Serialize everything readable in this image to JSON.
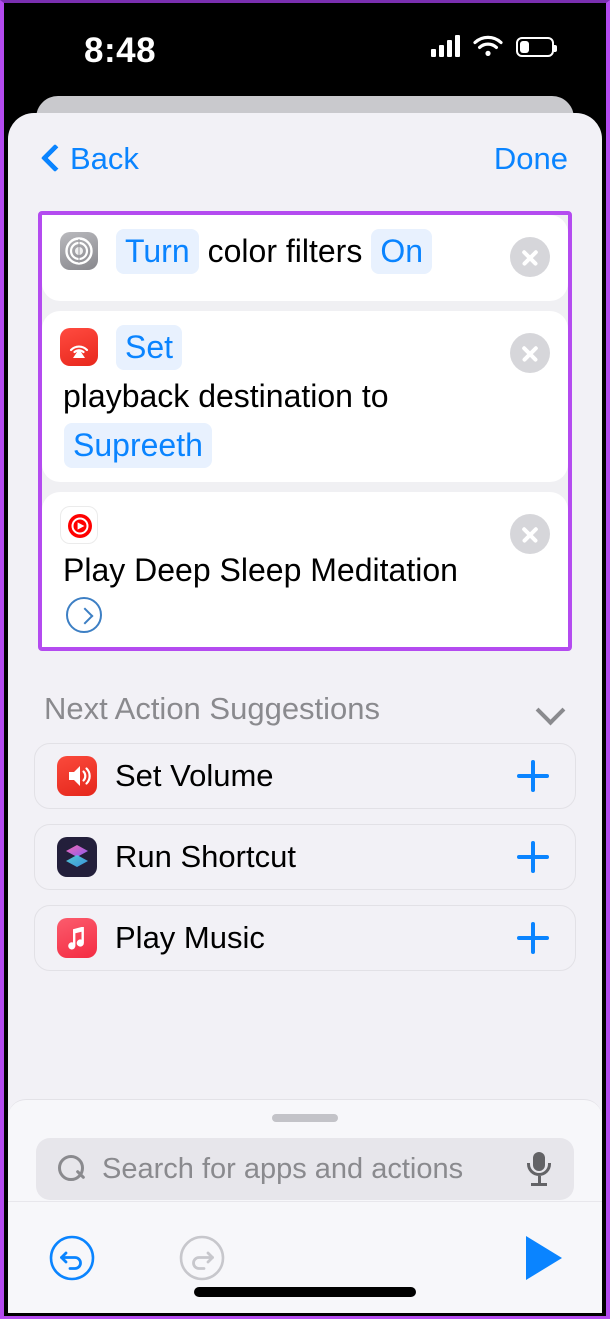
{
  "statusbar": {
    "time": "8:48",
    "signal_icon": "cellular-signal-icon",
    "wifi_icon": "wifi-icon",
    "battery_icon": "battery-icon",
    "battery_level_pct": 30
  },
  "navbar": {
    "back_label": "Back",
    "back_icon": "chevron-left-icon",
    "done_label": "Done"
  },
  "highlight": {
    "color": "#b44bf0"
  },
  "accent": {
    "blue": "#0a84ff",
    "chip_bg": "#e8f1fe",
    "gray_text": "#8a8a8e"
  },
  "actions": [
    {
      "icon": "accessibility-icon",
      "delete_icon": "close-circle-icon",
      "tokens": [
        {
          "text": "Turn",
          "type": "chip"
        },
        {
          "text": "color filters",
          "type": "plain"
        },
        {
          "text": "On",
          "type": "chip"
        }
      ]
    },
    {
      "icon": "airplay-icon",
      "delete_icon": "close-circle-icon",
      "tokens": [
        {
          "text": "Set",
          "type": "chip"
        },
        {
          "text": "playback destination to",
          "type": "plain"
        },
        {
          "text": "Supreeth",
          "type": "chip"
        }
      ]
    },
    {
      "icon": "youtube-music-icon",
      "delete_icon": "close-circle-icon",
      "tokens": [
        {
          "text": "Play Deep Sleep Meditation",
          "type": "plain"
        },
        {
          "text": "",
          "type": "chevron"
        }
      ]
    }
  ],
  "suggestions": {
    "title": "Next Action Suggestions",
    "collapse_icon": "chevron-down-icon",
    "items": [
      {
        "label": "Set Volume",
        "icon": "volume-icon",
        "add_icon": "plus-icon"
      },
      {
        "label": "Run Shortcut",
        "icon": "shortcuts-icon",
        "add_icon": "plus-icon"
      },
      {
        "label": "Play Music",
        "icon": "apple-music-icon",
        "add_icon": "plus-icon"
      }
    ]
  },
  "search": {
    "placeholder": "Search for apps and actions",
    "value": "",
    "search_icon": "search-icon",
    "mic_icon": "microphone-icon",
    "grabber": "drag-handle"
  },
  "toolbar": {
    "undo_icon": "undo-icon",
    "undo_enabled": true,
    "redo_icon": "redo-icon",
    "redo_enabled": false,
    "play_icon": "play-icon"
  }
}
